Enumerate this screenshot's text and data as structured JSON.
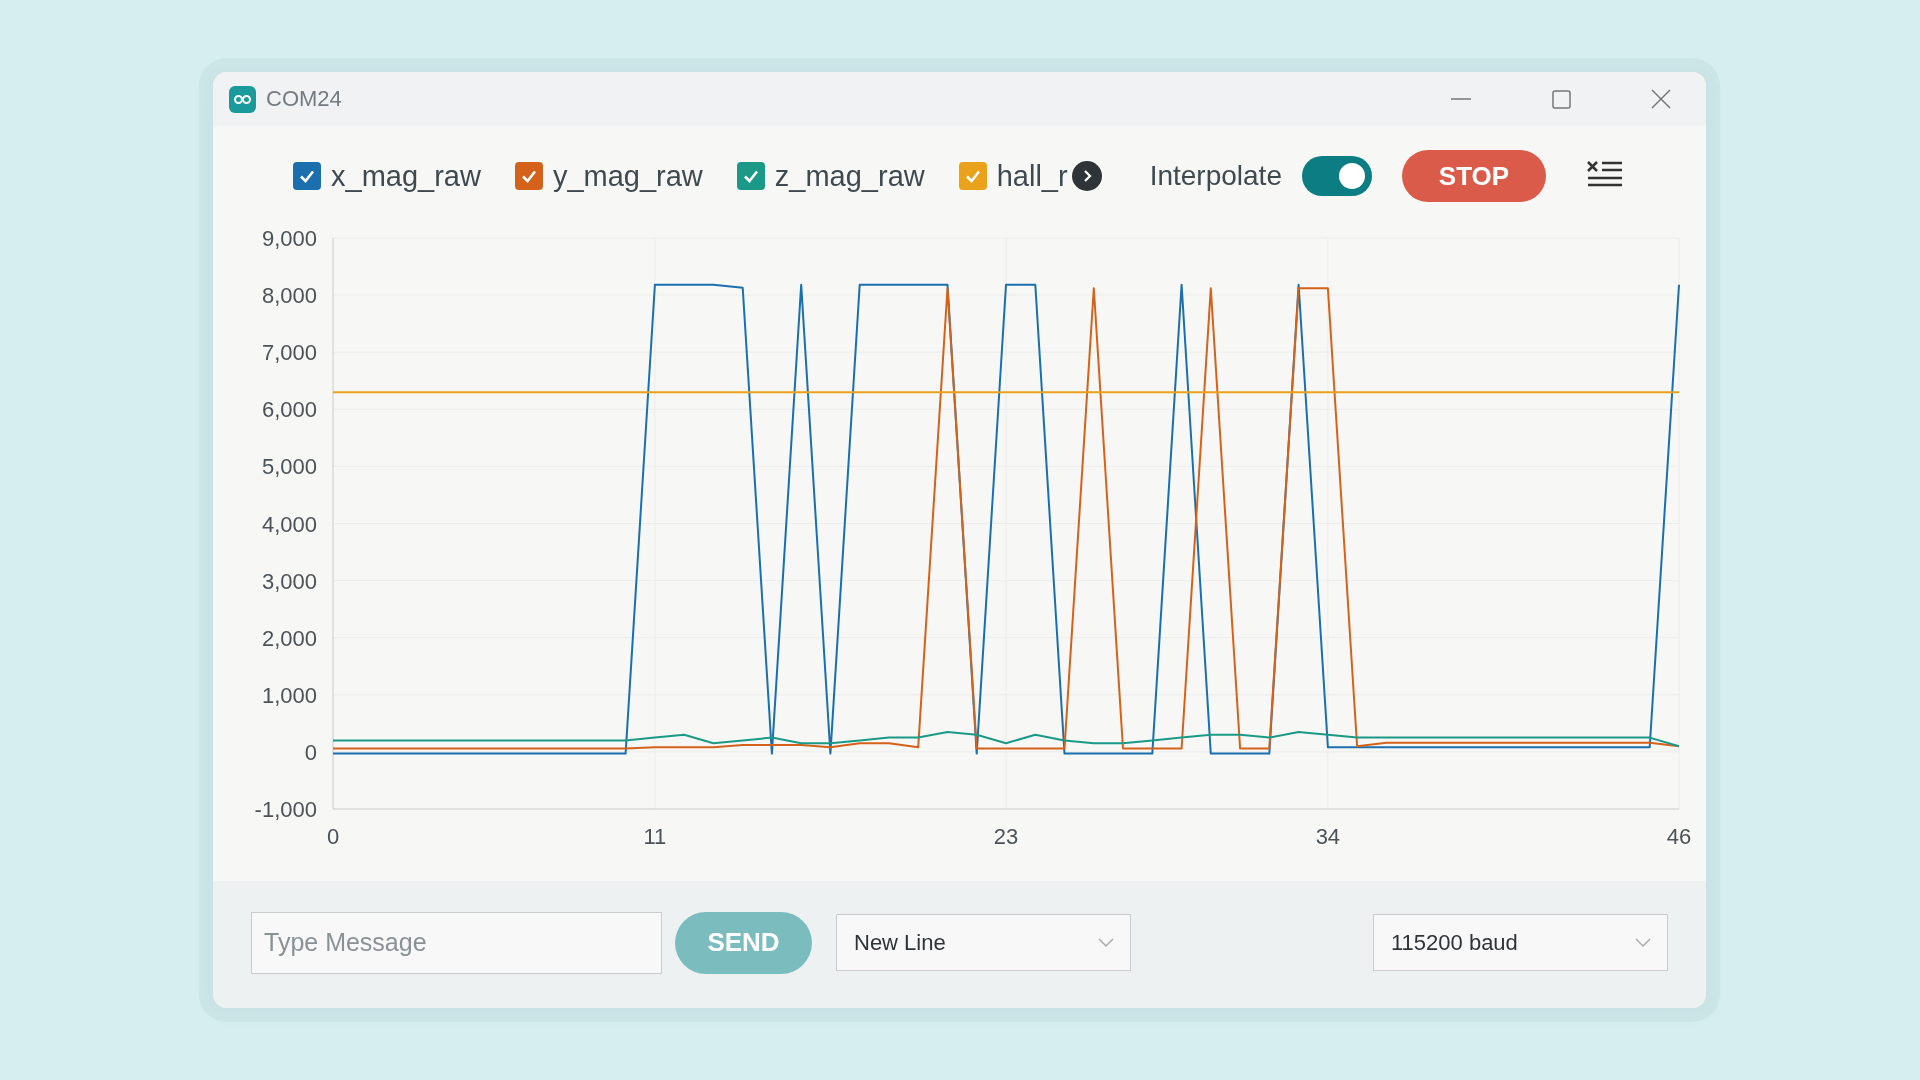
{
  "window": {
    "title": "COM24"
  },
  "legend": [
    {
      "checked": true
    },
    {
      "checked": true
    },
    {
      "checked": true
    },
    {
      "checked": true
    }
  ],
  "interpolate": {
    "label": "Interpolate",
    "on": true
  },
  "stop_button": "STOP",
  "chart_data": {
    "type": "line",
    "grid": true,
    "xlim": [
      0,
      46
    ],
    "ylim": [
      -1000,
      9000
    ],
    "xticks": [
      0,
      11,
      23,
      34,
      46
    ],
    "yticks": [
      {
        "value": -1000,
        "label": "-1,000"
      },
      {
        "value": 0,
        "label": "0"
      },
      {
        "value": 1000,
        "label": "1,000"
      },
      {
        "value": 2000,
        "label": "2,000"
      },
      {
        "value": 3000,
        "label": "3,000"
      },
      {
        "value": 4000,
        "label": "4,000"
      },
      {
        "value": 5000,
        "label": "5,000"
      },
      {
        "value": 6000,
        "label": "6,000"
      },
      {
        "value": 7000,
        "label": "7,000"
      },
      {
        "value": 8000,
        "label": "8,000"
      },
      {
        "value": 9000,
        "label": "9,000"
      }
    ],
    "x": [
      0,
      1,
      2,
      3,
      4,
      5,
      6,
      7,
      8,
      9,
      10,
      11,
      12,
      13,
      14,
      15,
      16,
      17,
      18,
      19,
      20,
      21,
      22,
      23,
      24,
      25,
      26,
      27,
      28,
      29,
      30,
      31,
      32,
      33,
      34,
      35,
      36,
      37,
      38,
      39,
      40,
      41,
      42,
      43,
      44,
      45,
      46
    ],
    "series": [
      {
        "name": "x_mag_raw",
        "color": "#1b6fae",
        "values": [
          -30,
          -30,
          -30,
          -30,
          -30,
          -30,
          -30,
          -30,
          -30,
          -30,
          -30,
          8180,
          8180,
          8180,
          8130,
          -30,
          8180,
          -30,
          8180,
          8180,
          8180,
          8180,
          -30,
          8180,
          8180,
          -30,
          -30,
          -30,
          -30,
          8180,
          -30,
          -30,
          -30,
          8180,
          80,
          80,
          80,
          80,
          80,
          80,
          80,
          80,
          80,
          80,
          80,
          80,
          8180
        ]
      },
      {
        "name": "y_mag_raw",
        "color": "#d5621a",
        "values": [
          60,
          60,
          60,
          60,
          60,
          60,
          60,
          60,
          60,
          60,
          60,
          80,
          80,
          80,
          120,
          120,
          120,
          80,
          150,
          150,
          80,
          8120,
          60,
          60,
          60,
          60,
          8120,
          60,
          60,
          60,
          8120,
          60,
          60,
          8120,
          8120,
          100,
          160,
          160,
          160,
          160,
          160,
          160,
          160,
          160,
          160,
          160,
          100
        ]
      },
      {
        "name": "z_mag_raw",
        "color": "#1a9a86",
        "values": [
          200,
          200,
          200,
          200,
          200,
          200,
          200,
          200,
          200,
          200,
          200,
          250,
          300,
          150,
          200,
          250,
          150,
          150,
          200,
          250,
          250,
          350,
          300,
          150,
          300,
          200,
          150,
          150,
          200,
          250,
          300,
          300,
          250,
          350,
          300,
          250,
          250,
          250,
          250,
          250,
          250,
          250,
          250,
          250,
          250,
          250,
          100
        ]
      },
      {
        "name": "hall_r",
        "color": "#e9a21a",
        "values": [
          6300,
          6300,
          6300,
          6300,
          6300,
          6300,
          6300,
          6300,
          6300,
          6300,
          6300,
          6300,
          6300,
          6300,
          6300,
          6300,
          6300,
          6300,
          6300,
          6300,
          6300,
          6300,
          6300,
          6300,
          6300,
          6300,
          6300,
          6300,
          6300,
          6300,
          6300,
          6300,
          6300,
          6300,
          6300,
          6300,
          6300,
          6300,
          6300,
          6300,
          6300,
          6300,
          6300,
          6300,
          6300,
          6300,
          6300
        ]
      }
    ]
  },
  "message_field": {
    "placeholder": "Type Message"
  },
  "send_button": "SEND",
  "line_ending": {
    "value": "New Line"
  },
  "baud_rate": {
    "value": "115200 baud"
  }
}
